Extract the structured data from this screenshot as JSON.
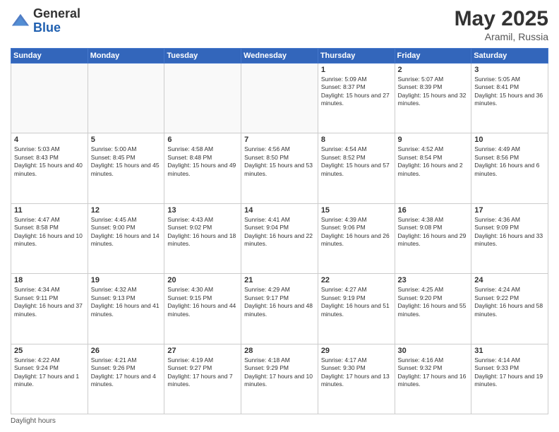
{
  "header": {
    "logo_general": "General",
    "logo_blue": "Blue",
    "month_title": "May 2025",
    "location": "Aramil, Russia"
  },
  "days_of_week": [
    "Sunday",
    "Monday",
    "Tuesday",
    "Wednesday",
    "Thursday",
    "Friday",
    "Saturday"
  ],
  "footer": {
    "daylight_hours": "Daylight hours"
  },
  "weeks": [
    [
      {
        "day": "",
        "empty": true
      },
      {
        "day": "",
        "empty": true
      },
      {
        "day": "",
        "empty": true
      },
      {
        "day": "",
        "empty": true
      },
      {
        "day": "1",
        "sunrise": "5:09 AM",
        "sunset": "8:37 PM",
        "daylight": "15 hours and 27 minutes."
      },
      {
        "day": "2",
        "sunrise": "5:07 AM",
        "sunset": "8:39 PM",
        "daylight": "15 hours and 32 minutes."
      },
      {
        "day": "3",
        "sunrise": "5:05 AM",
        "sunset": "8:41 PM",
        "daylight": "15 hours and 36 minutes."
      }
    ],
    [
      {
        "day": "4",
        "sunrise": "5:03 AM",
        "sunset": "8:43 PM",
        "daylight": "15 hours and 40 minutes."
      },
      {
        "day": "5",
        "sunrise": "5:00 AM",
        "sunset": "8:45 PM",
        "daylight": "15 hours and 45 minutes."
      },
      {
        "day": "6",
        "sunrise": "4:58 AM",
        "sunset": "8:48 PM",
        "daylight": "15 hours and 49 minutes."
      },
      {
        "day": "7",
        "sunrise": "4:56 AM",
        "sunset": "8:50 PM",
        "daylight": "15 hours and 53 minutes."
      },
      {
        "day": "8",
        "sunrise": "4:54 AM",
        "sunset": "8:52 PM",
        "daylight": "15 hours and 57 minutes."
      },
      {
        "day": "9",
        "sunrise": "4:52 AM",
        "sunset": "8:54 PM",
        "daylight": "16 hours and 2 minutes."
      },
      {
        "day": "10",
        "sunrise": "4:49 AM",
        "sunset": "8:56 PM",
        "daylight": "16 hours and 6 minutes."
      }
    ],
    [
      {
        "day": "11",
        "sunrise": "4:47 AM",
        "sunset": "8:58 PM",
        "daylight": "16 hours and 10 minutes."
      },
      {
        "day": "12",
        "sunrise": "4:45 AM",
        "sunset": "9:00 PM",
        "daylight": "16 hours and 14 minutes."
      },
      {
        "day": "13",
        "sunrise": "4:43 AM",
        "sunset": "9:02 PM",
        "daylight": "16 hours and 18 minutes."
      },
      {
        "day": "14",
        "sunrise": "4:41 AM",
        "sunset": "9:04 PM",
        "daylight": "16 hours and 22 minutes."
      },
      {
        "day": "15",
        "sunrise": "4:39 AM",
        "sunset": "9:06 PM",
        "daylight": "16 hours and 26 minutes."
      },
      {
        "day": "16",
        "sunrise": "4:38 AM",
        "sunset": "9:08 PM",
        "daylight": "16 hours and 29 minutes."
      },
      {
        "day": "17",
        "sunrise": "4:36 AM",
        "sunset": "9:09 PM",
        "daylight": "16 hours and 33 minutes."
      }
    ],
    [
      {
        "day": "18",
        "sunrise": "4:34 AM",
        "sunset": "9:11 PM",
        "daylight": "16 hours and 37 minutes."
      },
      {
        "day": "19",
        "sunrise": "4:32 AM",
        "sunset": "9:13 PM",
        "daylight": "16 hours and 41 minutes."
      },
      {
        "day": "20",
        "sunrise": "4:30 AM",
        "sunset": "9:15 PM",
        "daylight": "16 hours and 44 minutes."
      },
      {
        "day": "21",
        "sunrise": "4:29 AM",
        "sunset": "9:17 PM",
        "daylight": "16 hours and 48 minutes."
      },
      {
        "day": "22",
        "sunrise": "4:27 AM",
        "sunset": "9:19 PM",
        "daylight": "16 hours and 51 minutes."
      },
      {
        "day": "23",
        "sunrise": "4:25 AM",
        "sunset": "9:20 PM",
        "daylight": "16 hours and 55 minutes."
      },
      {
        "day": "24",
        "sunrise": "4:24 AM",
        "sunset": "9:22 PM",
        "daylight": "16 hours and 58 minutes."
      }
    ],
    [
      {
        "day": "25",
        "sunrise": "4:22 AM",
        "sunset": "9:24 PM",
        "daylight": "17 hours and 1 minute."
      },
      {
        "day": "26",
        "sunrise": "4:21 AM",
        "sunset": "9:26 PM",
        "daylight": "17 hours and 4 minutes."
      },
      {
        "day": "27",
        "sunrise": "4:19 AM",
        "sunset": "9:27 PM",
        "daylight": "17 hours and 7 minutes."
      },
      {
        "day": "28",
        "sunrise": "4:18 AM",
        "sunset": "9:29 PM",
        "daylight": "17 hours and 10 minutes."
      },
      {
        "day": "29",
        "sunrise": "4:17 AM",
        "sunset": "9:30 PM",
        "daylight": "17 hours and 13 minutes."
      },
      {
        "day": "30",
        "sunrise": "4:16 AM",
        "sunset": "9:32 PM",
        "daylight": "17 hours and 16 minutes."
      },
      {
        "day": "31",
        "sunrise": "4:14 AM",
        "sunset": "9:33 PM",
        "daylight": "17 hours and 19 minutes."
      }
    ]
  ]
}
